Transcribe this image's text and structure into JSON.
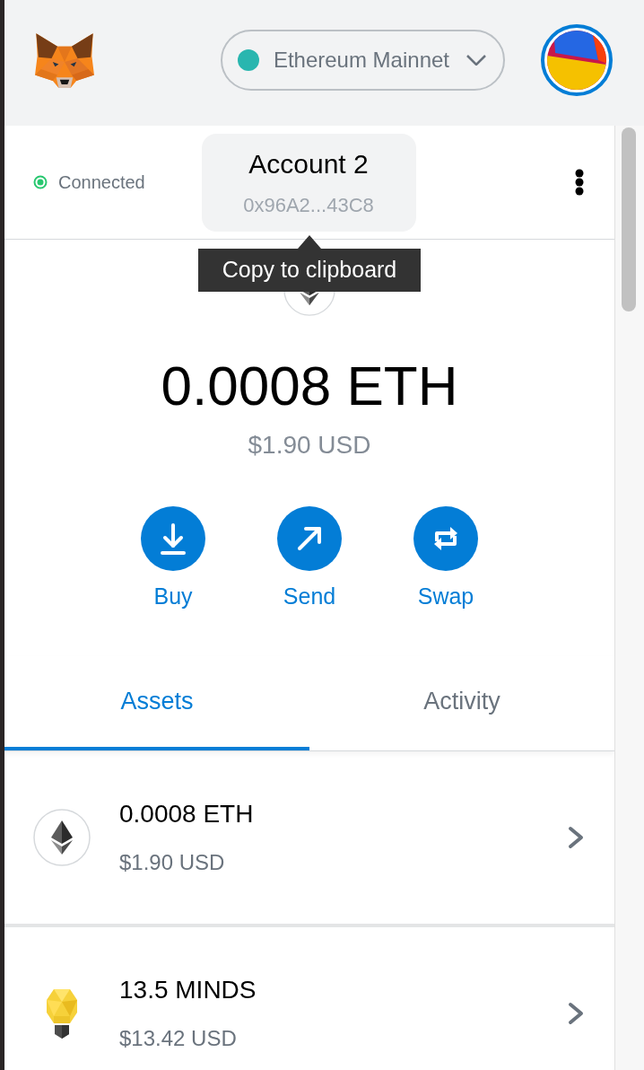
{
  "header": {
    "network": "Ethereum Mainnet"
  },
  "account": {
    "status": {
      "label": "Connected",
      "connected": true
    },
    "name": "Account 2",
    "address": "0x96A2...43C8",
    "tooltip": "Copy to clipboard"
  },
  "balance": {
    "amount": "0.0008 ETH",
    "fiat": "$1.90 USD"
  },
  "actions": [
    {
      "kind": "buy",
      "label": "Buy"
    },
    {
      "kind": "send",
      "label": "Send"
    },
    {
      "kind": "swap",
      "label": "Swap"
    }
  ],
  "tabs": [
    {
      "label": "Assets",
      "selected": true
    },
    {
      "label": "Activity",
      "selected": false
    }
  ],
  "assets": [
    {
      "kind": "eth",
      "amount": "0.0008 ETH",
      "value": "$1.90 USD"
    },
    {
      "kind": "minds",
      "amount": "13.5 MINDS",
      "value": "$13.42 USD"
    }
  ]
}
